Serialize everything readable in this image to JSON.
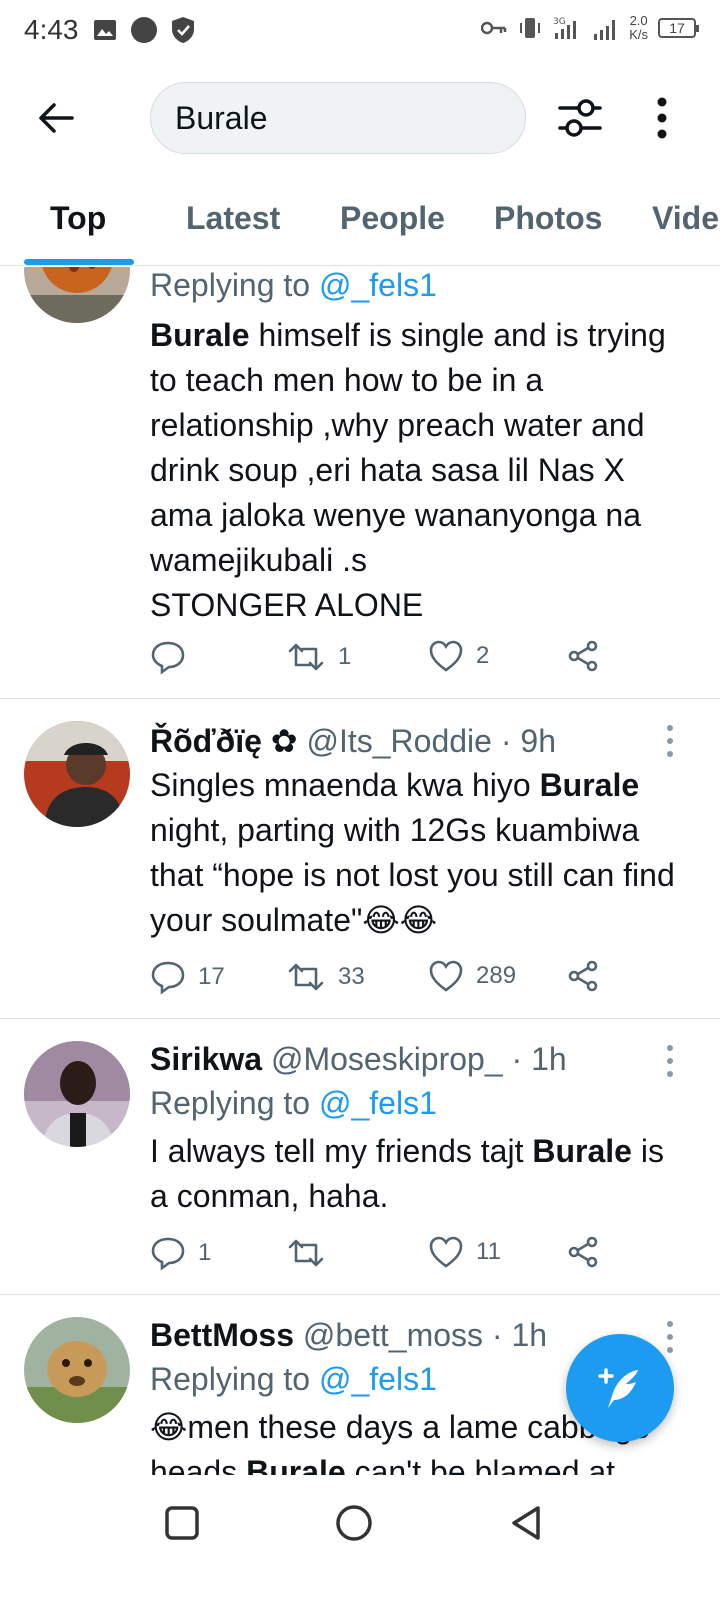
{
  "status_bar": {
    "time": "4:43",
    "net_speed": "2.0",
    "net_unit": "K/s",
    "battery": "17"
  },
  "search": {
    "query": "Burale"
  },
  "tabs": [
    {
      "label": "Top",
      "active": true
    },
    {
      "label": "Latest",
      "active": false
    },
    {
      "label": "People",
      "active": false
    },
    {
      "label": "Photos",
      "active": false
    },
    {
      "label": "Vide",
      "active": false
    }
  ],
  "tweets": [
    {
      "replying_prefix": "Replying to",
      "replying_handle": "@_fels1",
      "text_bold": "Burale",
      "text_rest": " himself is single and is trying to teach men how to be in a relationship ,why preach water and drink soup ,eri hata sasa lil Nas X ama jaloka wenye wananyonga na wamejikubali .s",
      "text_line2": "STONGER ALONE",
      "replies": "",
      "retweets": "1",
      "likes": "2"
    },
    {
      "name": "Řõďðïę",
      "badge": "✿",
      "handle": "@Its_Roddie",
      "time": "· 9h",
      "text_pre": "Singles mnaenda kwa hiyo ",
      "text_bold": "Burale",
      "text_rest": " night, parting with 12Gs kuambiwa that “hope is not lost you still can find your soulmate\"😂😂",
      "replies": "17",
      "retweets": "33",
      "likes": "289"
    },
    {
      "name": "Sirikwa",
      "handle": "@Moseskiprop_",
      "time": "· 1h",
      "replying_prefix": "Replying to",
      "replying_handle": "@_fels1",
      "text_pre": "I always tell my friends tajt ",
      "text_bold": "Burale",
      "text_rest": " is a conman, haha.",
      "replies": "1",
      "retweets": "",
      "likes": "11"
    },
    {
      "name": "BettMoss",
      "handle": "@bett_moss",
      "time": "· 1h",
      "replying_prefix": "Replying to",
      "replying_handle": "@_fels1",
      "text_line1": "😂men these days a lame cabbage",
      "text_line2_pre": "heads ",
      "text_line2_bold": "Burale",
      "text_line2_rest": " can't be blamed at"
    }
  ],
  "colors": {
    "accent": "#1d9bf0",
    "text": "#0f1419",
    "muted": "#536471"
  }
}
